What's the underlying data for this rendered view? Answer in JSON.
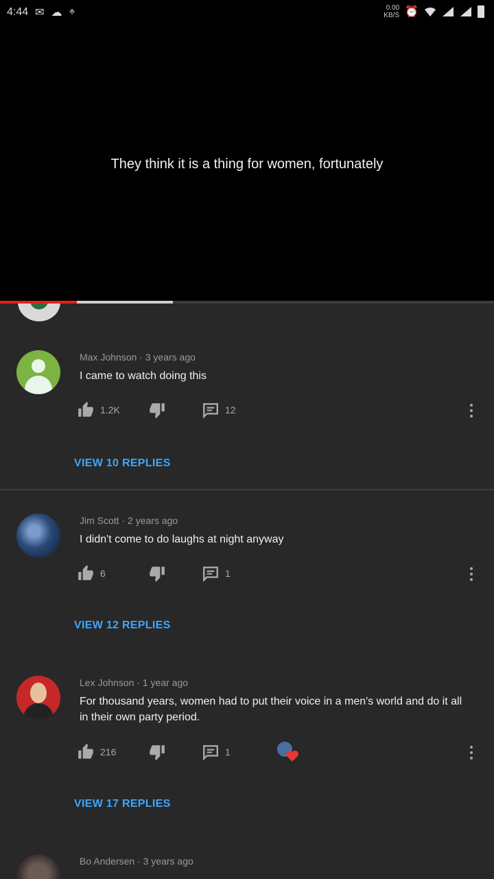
{
  "status_bar": {
    "time": "4:44",
    "net_speed_top": "0.00",
    "net_speed_bottom": "KB/S",
    "icons": [
      "message-icon",
      "cloud-icon",
      "location-icon",
      "alarm-icon",
      "wifi-icon",
      "signal-icon",
      "signal-icon",
      "battery-icon"
    ]
  },
  "video": {
    "caption": "They think it is a thing for women, fortunately",
    "progress_played": 0.155,
    "progress_buffered": 0.35
  },
  "colors": {
    "accent_red": "#e62117",
    "link_blue": "#3ea6ff",
    "background": "#282828"
  },
  "comments": [
    {
      "author": "Max Johnson",
      "age": "3 years ago",
      "text": "I came to watch doing this",
      "likes": "1.2K",
      "replies_count": "12",
      "view_replies": "VIEW 10 REPLIES",
      "avatar": "default-user-avatar"
    },
    {
      "author": "Jim Scott",
      "age": "2 years ago",
      "text": "I didn't come to do laughs at night anyway",
      "likes": "6",
      "replies_count": "1",
      "view_replies": "VIEW 12 REPLIES",
      "avatar": "earth-avatar"
    },
    {
      "author": "Lex Johnson",
      "age": "1 year ago",
      "text": "For thousand years, women had to put their voice in a men's world and do it all in their own party period.",
      "likes": "216",
      "replies_count": "1",
      "view_replies": "VIEW 17 REPLIES",
      "avatar": "person-avatar",
      "creator_heart": true
    },
    {
      "author": "Bo Andersen",
      "age": "3 years ago",
      "text": "",
      "avatar": "person-avatar"
    }
  ]
}
